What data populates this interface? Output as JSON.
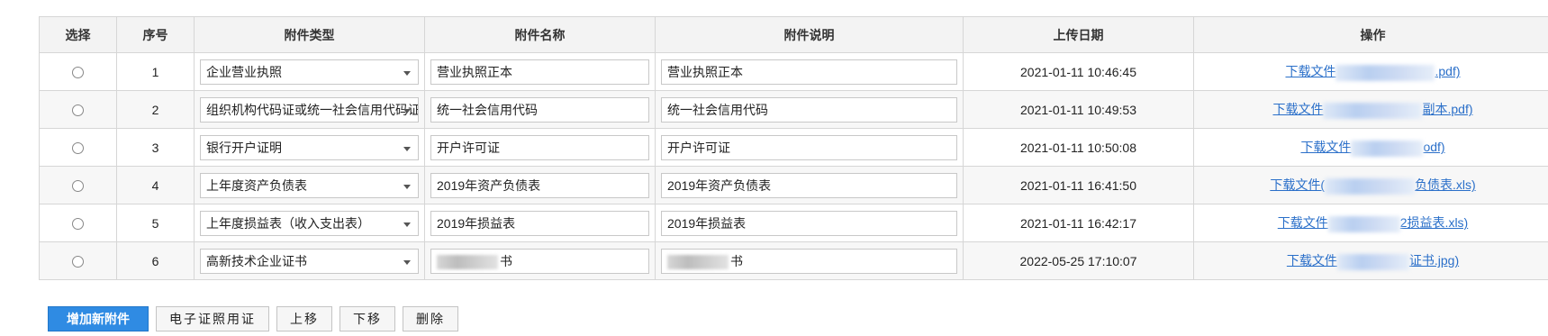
{
  "table": {
    "headers": [
      "选择",
      "序号",
      "附件类型",
      "附件名称",
      "附件说明",
      "上传日期",
      "操作"
    ],
    "rows": [
      {
        "index": "1",
        "type": "企业营业执照",
        "name": "营业执照正本",
        "desc": "营业执照正本",
        "date": "2021-01-11 10:46:45",
        "link_prefix": "下载文件",
        "link_suffix": ".pdf)"
      },
      {
        "index": "2",
        "type": "组织机构代码证或统一社会信用代码证",
        "name": "统一社会信用代码",
        "desc": "统一社会信用代码",
        "date": "2021-01-11 10:49:53",
        "link_prefix": "下载文件",
        "link_suffix": "副本.pdf)"
      },
      {
        "index": "3",
        "type": "银行开户证明",
        "name": "开户许可证",
        "desc": "开户许可证",
        "date": "2021-01-11 10:50:08",
        "link_prefix": "下载文件",
        "link_suffix": "odf)"
      },
      {
        "index": "4",
        "type": "上年度资产负债表",
        "name": "2019年资产负债表",
        "desc": "2019年资产负债表",
        "date": "2021-01-11 16:41:50",
        "link_prefix": "下载文件(",
        "link_suffix": "负债表.xls)"
      },
      {
        "index": "5",
        "type": "上年度损益表（收入支出表）",
        "name": "2019年损益表",
        "desc": "2019年损益表",
        "date": "2021-01-11 16:42:17",
        "link_prefix": "下载文件",
        "link_suffix": "2损益表.xls)"
      },
      {
        "index": "6",
        "type": "高新技术企业证书",
        "name_suffix": "书",
        "desc_suffix": "书",
        "date": "2022-05-25 17:10:07",
        "link_prefix": "下载文件",
        "link_suffix": "证书.jpg)"
      }
    ]
  },
  "buttons": {
    "add": "增加新附件",
    "ecert": "电子证照用证",
    "up": "上移",
    "down": "下移",
    "delete": "删除"
  },
  "colors": {
    "primary": "#2f8be3",
    "link": "#2a6fc9",
    "header_bg": "#f3f3f3"
  }
}
